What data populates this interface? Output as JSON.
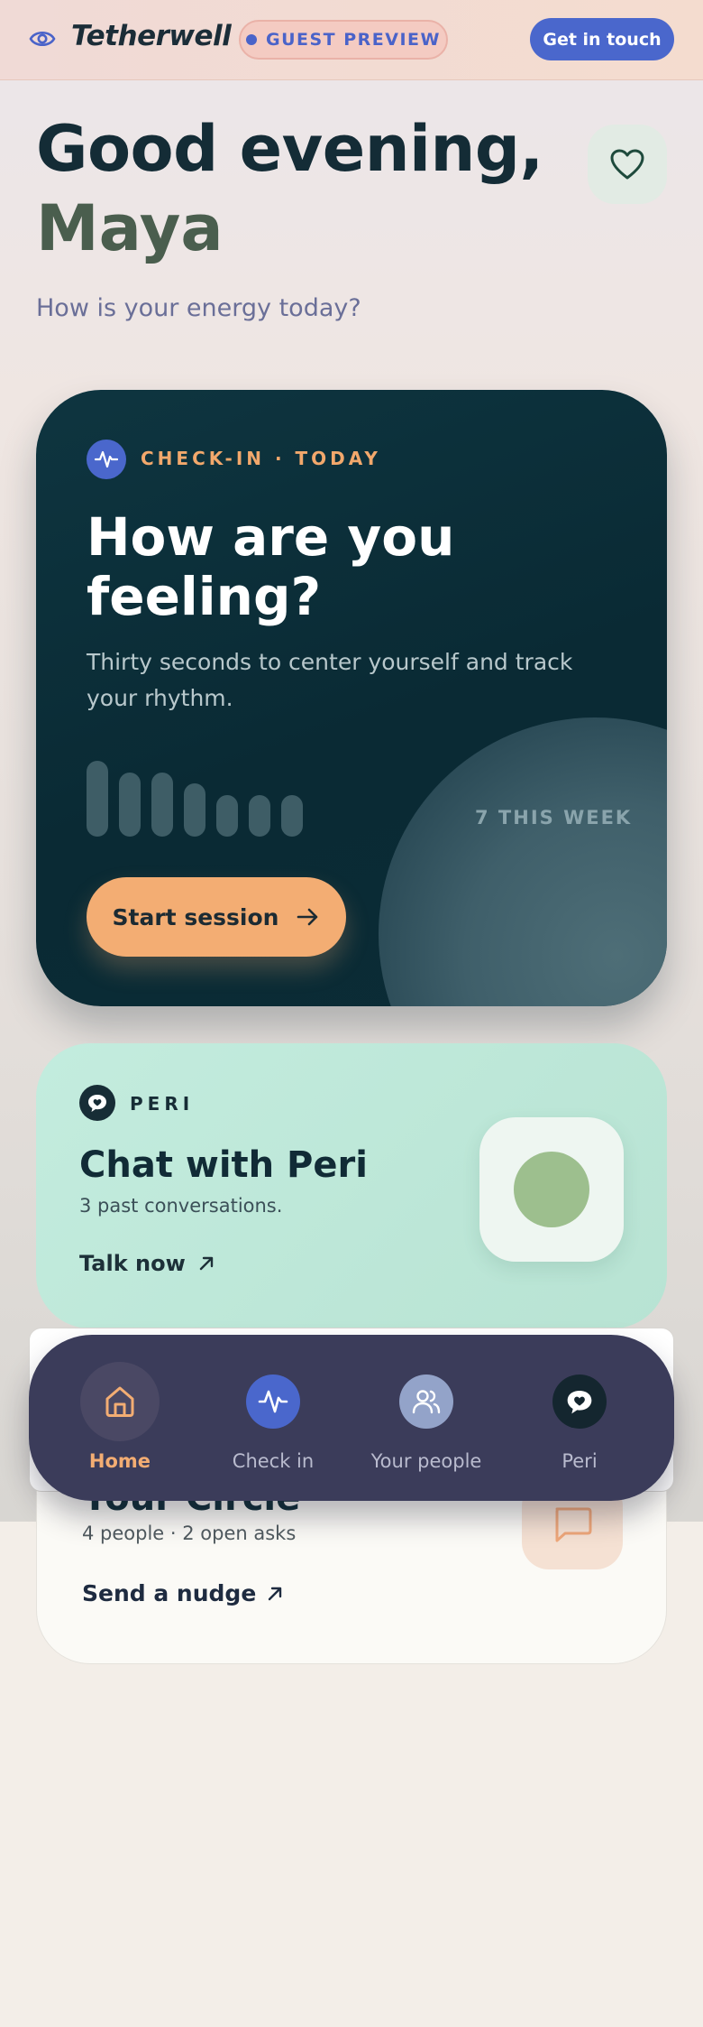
{
  "header": {
    "brand": "Tetherwell",
    "badge": "GUEST PREVIEW",
    "cta": "Get in touch",
    "logo_icon": "eye-icon"
  },
  "greeting": {
    "line1": "Good evening,",
    "name": "Maya",
    "question": "How is your energy today?",
    "favorite_icon": "heart-icon"
  },
  "checkin": {
    "label": "CHECK-IN · TODAY",
    "title": "How are you feeling?",
    "description": "Thirty seconds to center yourself and track your rhythm.",
    "week_count": "7 THIS WEEK",
    "button": "Start session",
    "icon": "activity-icon",
    "rhythm_levels": [
      1.0,
      0.85,
      0.85,
      0.7,
      0.55,
      0.55,
      0.55
    ]
  },
  "peri": {
    "label": "PERI",
    "title": "Chat with Peri",
    "subtitle": "3 past conversations.",
    "link": "Talk now",
    "icon": "heart-chat-icon"
  },
  "circle": {
    "title": "Your Circle",
    "subtitle": "4 people · 2 open asks",
    "link": "Send a nudge",
    "icon": "message-icon"
  },
  "nav": {
    "items": [
      {
        "label": "Home",
        "icon": "home-icon",
        "active": true
      },
      {
        "label": "Check in",
        "icon": "activity-icon",
        "active": false
      },
      {
        "label": "Your people",
        "icon": "users-icon",
        "active": false
      },
      {
        "label": "Peri",
        "icon": "heart-chat-icon",
        "active": false
      }
    ]
  },
  "colors": {
    "accent_blue": "#4a67cc",
    "accent_orange": "#f3ad73",
    "deep_teal": "#0b2c36",
    "mint": "#c3ecde",
    "nav_bg": "#3b3c5a"
  }
}
